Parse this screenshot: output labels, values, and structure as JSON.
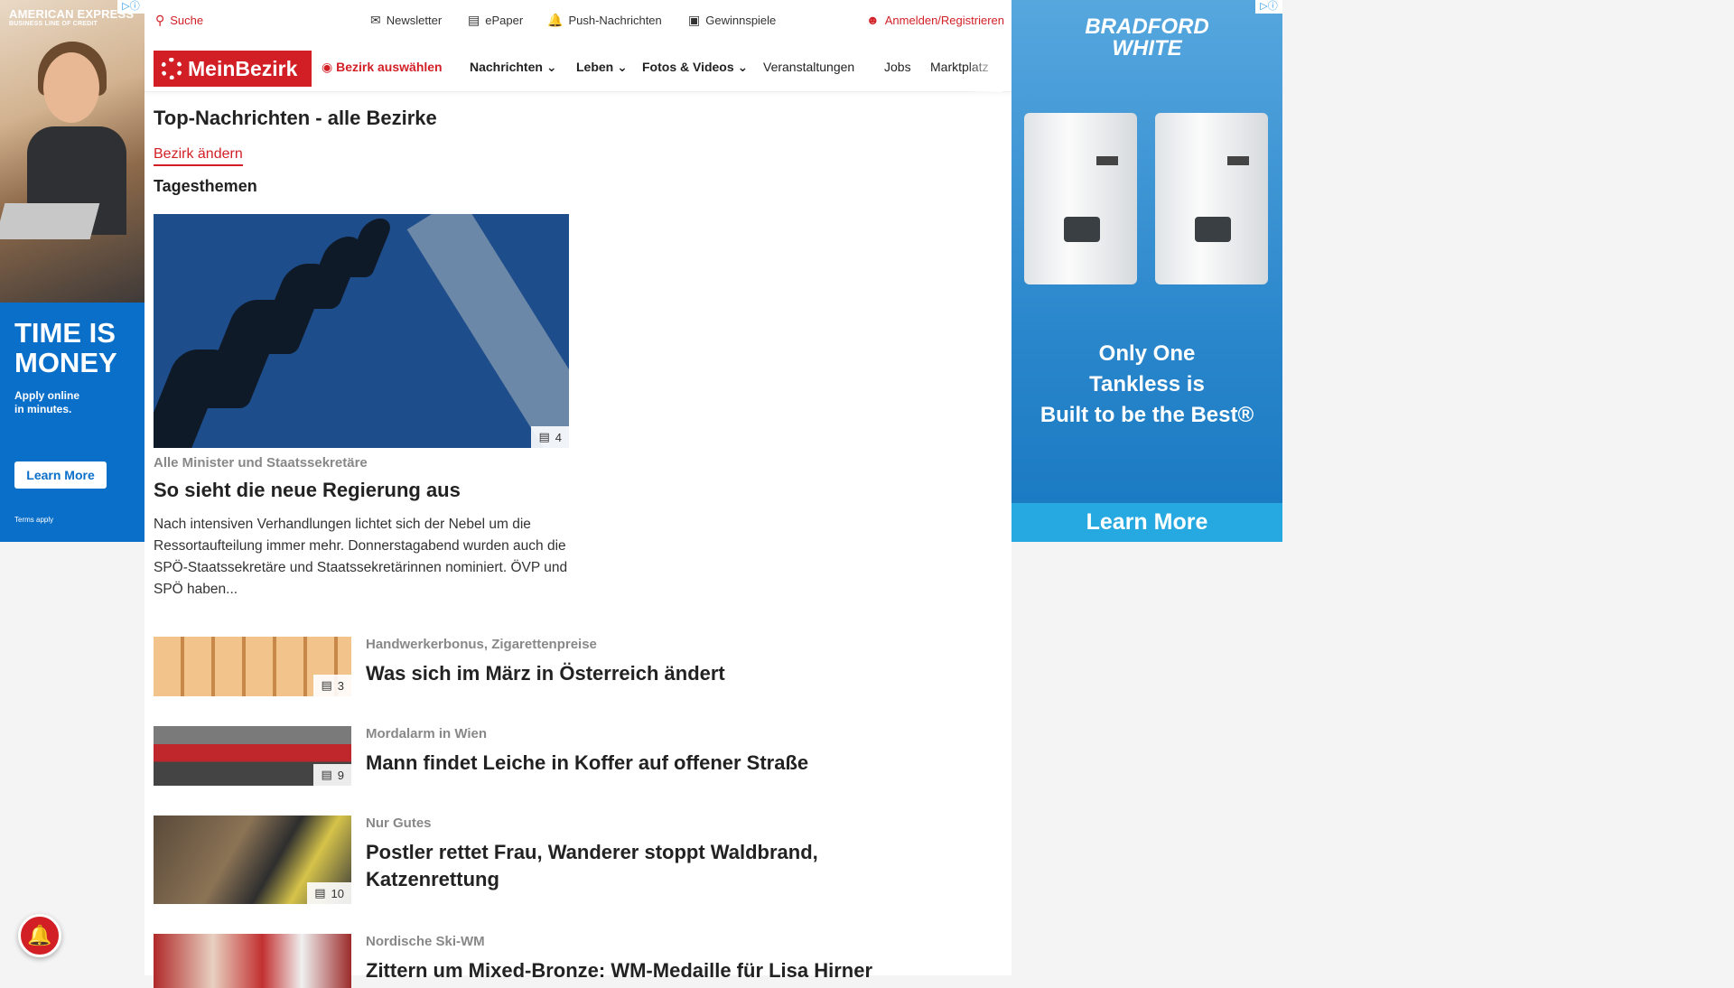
{
  "ad_left": {
    "brand": "AMERICAN EXPRESS",
    "brand_sub": "BUSINESS LINE OF CREDIT",
    "headline": "TIME IS MONEY",
    "sub": "Apply online\nin minutes.",
    "cta": "Learn More",
    "terms": "Terms apply",
    "adchoice": "▷ⓘ"
  },
  "topbar": {
    "search": "Suche",
    "newsletter": "Newsletter",
    "epaper": "ePaper",
    "push": "Push-Nachrichten",
    "gewinnspiele": "Gewinnspiele",
    "login": "Anmelden/Registrieren"
  },
  "nav": {
    "logo": "MeinBezirk",
    "bezirk": "Bezirk auswählen",
    "items": [
      "Nachrichten",
      "Leben",
      "Fotos & Videos",
      "Veranstaltungen",
      "Jobs",
      "Marktplatz"
    ]
  },
  "main": {
    "page_title": "Top-Nachrichten - alle Bezirke",
    "bezirk_change": "Bezirk ändern",
    "section_title": "Tagesthemen",
    "hero": {
      "kicker": "Alle Minister und Staatssekretäre",
      "title": "So sieht die neue Regierung aus",
      "teaser": "Nach intensiven Verhandlungen lichtet sich der Nebel um die Ressortaufteilung immer mehr. Donnerstagabend wurden auch die SPÖ-Staatssekretäre und Staatssekretärinnen nominiert. ÖVP und SPÖ haben...",
      "image_count": "4"
    },
    "articles": [
      {
        "kicker": "Handwerkerbonus, Zigarettenpreise",
        "title": "Was sich im März in Österreich ändert",
        "image_count": "3"
      },
      {
        "kicker": "Mordalarm in Wien",
        "title": "Mann findet Leiche in Koffer auf offener Straße",
        "image_count": "9"
      },
      {
        "kicker": "Nur Gutes",
        "title": "Postler rettet Frau, Wanderer stoppt Waldbrand, Katzenrettung",
        "image_count": "10"
      },
      {
        "kicker": "Nordische Ski-WM",
        "title": "Zittern um Mixed-Bronze: WM-Medaille für Lisa Hirner",
        "image_count": ""
      }
    ]
  },
  "ad_right": {
    "brand": "BRADFORD\nWHITE",
    "copy": "Only One\nTankless is\nBuilt to be the Best®",
    "cta": "Learn More",
    "adchoice": "▷ⓘ"
  },
  "colors": {
    "brand_red": "#d21f26",
    "amex_blue": "#0a6fc9",
    "bradford_blue": "#2b87cc"
  }
}
